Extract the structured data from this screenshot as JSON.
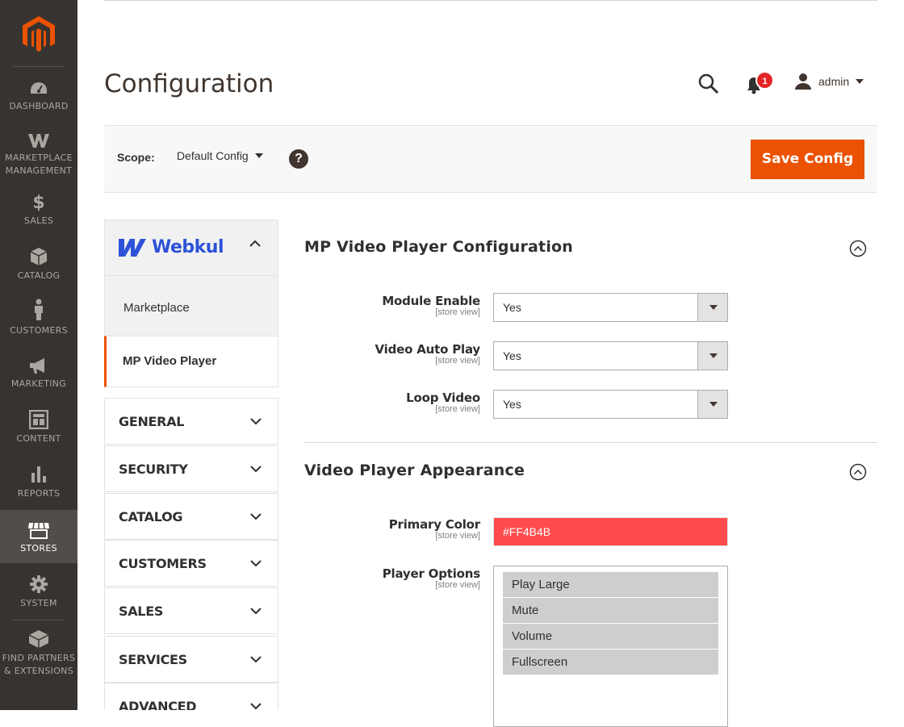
{
  "menu": {
    "items": [
      {
        "label": "DASHBOARD",
        "icon": "dashboard-icon"
      },
      {
        "label": "MARKETPLACE MANAGEMENT",
        "icon": "webkul-w-icon"
      },
      {
        "label": "SALES",
        "icon": "dollar-icon"
      },
      {
        "label": "CATALOG",
        "icon": "box-icon"
      },
      {
        "label": "CUSTOMERS",
        "icon": "person-icon"
      },
      {
        "label": "MARKETING",
        "icon": "megaphone-icon"
      },
      {
        "label": "CONTENT",
        "icon": "layout-icon"
      },
      {
        "label": "REPORTS",
        "icon": "bar-chart-icon"
      },
      {
        "label": "STORES",
        "icon": "store-icon",
        "active": true
      },
      {
        "label": "SYSTEM",
        "icon": "gear-icon"
      },
      {
        "label": "FIND PARTNERS & EXTENSIONS",
        "icon": "extensions-icon"
      }
    ]
  },
  "header": {
    "title": "Configuration",
    "notification_count": "1",
    "user": "admin"
  },
  "scope": {
    "label": "Scope:",
    "value": "Default Config",
    "help": "?"
  },
  "actions": {
    "save_label": "Save Config"
  },
  "tabs": {
    "vendor": "Webkul",
    "vendor_items": [
      "Marketplace",
      "MP Video Player"
    ],
    "sections": [
      "GENERAL",
      "SECURITY",
      "CATALOG",
      "CUSTOMERS",
      "SALES",
      "SERVICES",
      "ADVANCED"
    ]
  },
  "config": {
    "section1": {
      "title": "MP Video Player Configuration",
      "fields": [
        {
          "label": "Module Enable",
          "scope": "[store view]",
          "value": "Yes"
        },
        {
          "label": "Video Auto Play",
          "scope": "[store view]",
          "value": "Yes"
        },
        {
          "label": "Loop Video",
          "scope": "[store view]",
          "value": "Yes"
        }
      ]
    },
    "section2": {
      "title": "Video Player Appearance",
      "primary_color": {
        "label": "Primary Color",
        "scope": "[store view]",
        "value": "#FF4B4B"
      },
      "player_options": {
        "label": "Player Options",
        "scope": "[store view]",
        "options": [
          "Play Large",
          "Mute",
          "Volume",
          "Fullscreen"
        ]
      }
    }
  },
  "colors": {
    "accent": "#eb5202",
    "sidebar": "#373330",
    "webkul_blue": "#2d52d8"
  }
}
